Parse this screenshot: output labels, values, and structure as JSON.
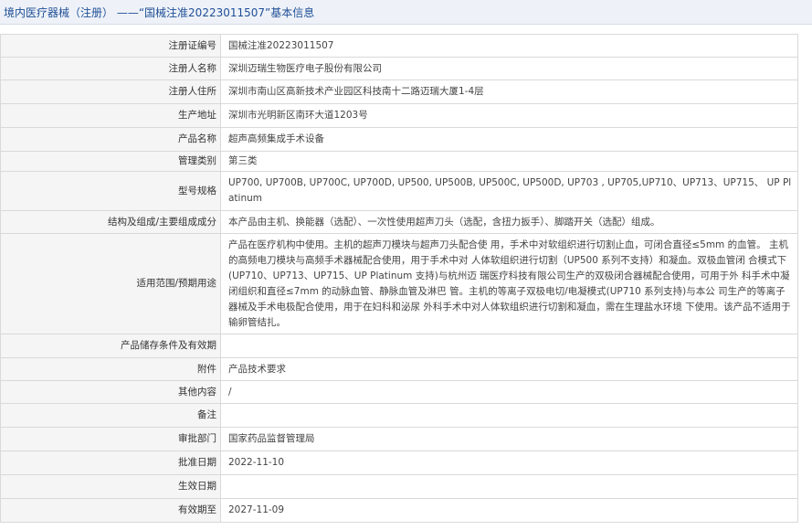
{
  "header": {
    "prefix": "境内医疗器械（注册） ——",
    "title": "“国械注准20223011507”基本信息"
  },
  "rows": [
    {
      "label": "注册证编号",
      "value": "国械注准20223011507"
    },
    {
      "label": "注册人名称",
      "value": "深圳迈瑞生物医疗电子股份有限公司"
    },
    {
      "label": "注册人住所",
      "value": "深圳市南山区高新技术产业园区科技南十二路迈瑞大厦1-4层"
    },
    {
      "label": "生产地址",
      "value": "深圳市光明新区南环大道1203号"
    },
    {
      "label": "产品名称",
      "value": "超声高频集成手术设备"
    },
    {
      "label": "管理类别",
      "value": "第三类"
    },
    {
      "label": "型号规格",
      "value": "UP700, UP700B, UP700C, UP700D, UP500, UP500B, UP500C, UP500D, UP703 , UP705,UP710、UP713、UP715、 UP Platinum"
    },
    {
      "label": "结构及组成/主要组成成分",
      "value": "本产品由主机、换能器（选配）、一次性使用超声刀头（选配，含扭力扳手）、脚踏开关（选配）组成。"
    },
    {
      "label": "适用范围/预期用途",
      "value": "产品在医疗机构中使用。主机的超声刀模块与超声刀头配合使 用，手术中对软组织进行切割止血，可闭合直径≤5mm 的血管。 主机的高频电刀模块与高频手术器械配合使用，用于手术中对 人体软组织进行切割（UP500 系列不支持）和凝血。双极血管闭 合模式下(UP710、UP713、UP715、UP Platinum 支持)与杭州迈 瑞医疗科技有限公司生产的双极闭合器械配合使用，可用于外 科手术中凝闭组织和直径≤7mm 的动脉血管、静脉血管及淋巴 管。主机的等离子双极电切/电凝模式(UP710 系列支持)与本公 司生产的等离子器械及手术电极配合使用，用于在妇科和泌尿 外科手术中对人体软组织进行切割和凝血，需在生理盐水环境 下使用。该产品不适用于输卵管结扎。"
    },
    {
      "label": "产品储存条件及有效期",
      "value": ""
    },
    {
      "label": "附件",
      "value": "产品技术要求"
    },
    {
      "label": "其他内容",
      "value": "/"
    },
    {
      "label": "备注",
      "value": ""
    },
    {
      "label": "审批部门",
      "value": "国家药品监督管理局"
    },
    {
      "label": "批准日期",
      "value": "2022-11-10"
    },
    {
      "label": "生效日期",
      "value": ""
    },
    {
      "label": "有效期至",
      "value": "2027-11-09"
    }
  ]
}
